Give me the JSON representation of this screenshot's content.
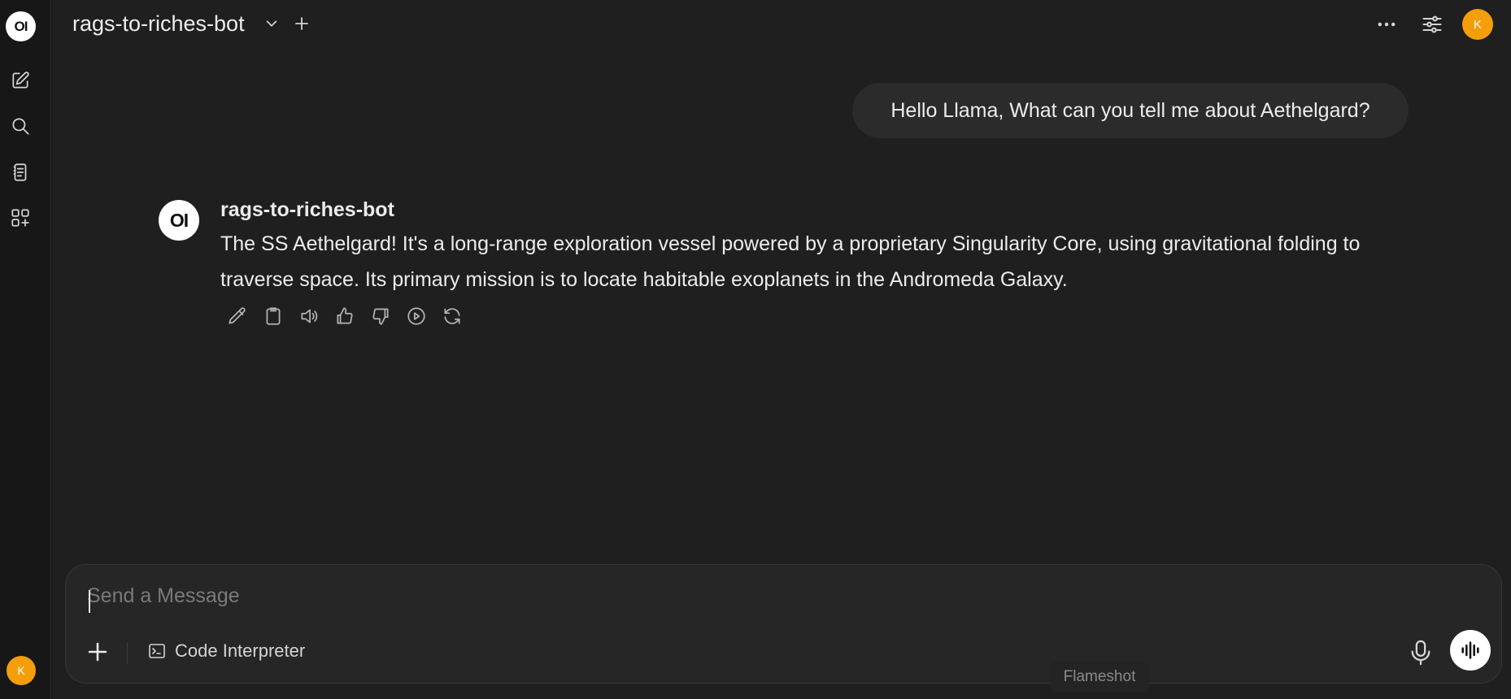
{
  "colors": {
    "background": "#1f1f1f",
    "sidebar": "#171717",
    "user_avatar": "#f59e0b",
    "bubble": "#2b2b2b",
    "composer": "#262626"
  },
  "sidebar": {
    "logo_text": "OI",
    "items": [
      {
        "name": "new-chat",
        "icon": "pencil-square-icon"
      },
      {
        "name": "search",
        "icon": "search-icon"
      },
      {
        "name": "notes",
        "icon": "document-icon"
      },
      {
        "name": "workspace",
        "icon": "grid-plus-icon"
      }
    ],
    "user_initial": "K"
  },
  "header": {
    "model_name": "rags-to-riches-bot",
    "user_initial": "K",
    "icons": [
      "chevron-down-icon",
      "plus-icon",
      "more-icon",
      "controls-icon"
    ]
  },
  "messages": {
    "user": {
      "text": "Hello Llama, What can you tell me about Aethelgard?"
    },
    "assistant": {
      "avatar_text": "OI",
      "name": "rags-to-riches-bot",
      "text": "The SS Aethelgard! It's a long-range exploration vessel powered by a proprietary Singularity Core, using gravitational folding to traverse space. Its primary mission is to locate habitable exoplanets in the Andromeda Galaxy.",
      "actions": [
        "edit-icon",
        "copy-icon",
        "read-aloud-icon",
        "thumbs-up-icon",
        "thumbs-down-icon",
        "continue-icon",
        "regenerate-icon"
      ]
    }
  },
  "composer": {
    "placeholder": "Send a Message",
    "value": "",
    "code_interpreter_label": "Code Interpreter"
  },
  "tooltip": {
    "text": "Flameshot"
  }
}
